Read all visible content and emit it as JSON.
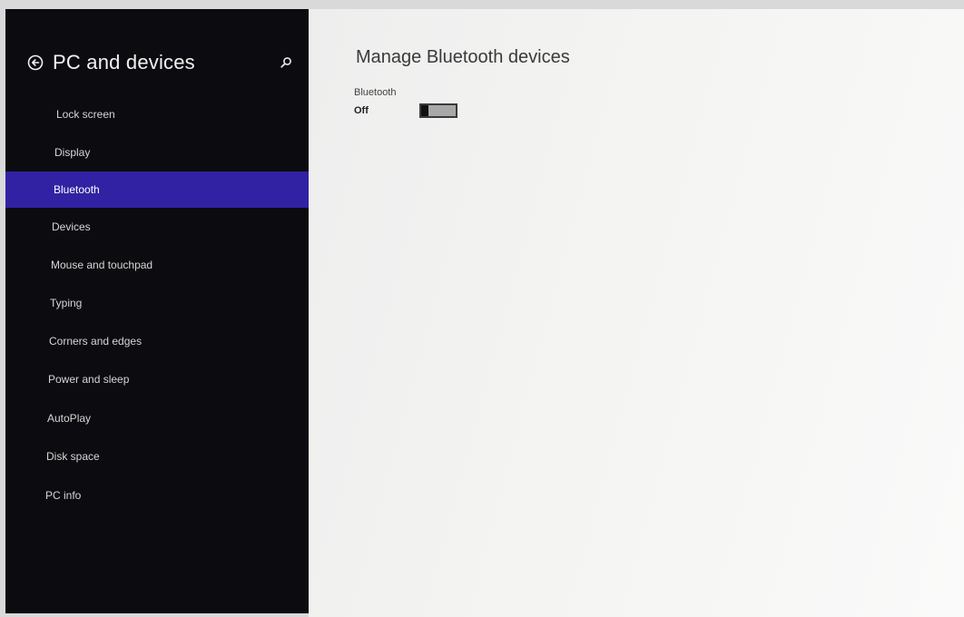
{
  "sidebar": {
    "title": "PC and devices",
    "back_icon": "back-arrow-circle-icon",
    "search_icon": "search-icon",
    "items": [
      {
        "label": "Lock screen",
        "selected": false
      },
      {
        "label": "Display",
        "selected": false
      },
      {
        "label": "Bluetooth",
        "selected": true
      },
      {
        "label": "Devices",
        "selected": false
      },
      {
        "label": "Mouse and touchpad",
        "selected": false
      },
      {
        "label": "Typing",
        "selected": false
      },
      {
        "label": "Corners and edges",
        "selected": false
      },
      {
        "label": "Power and sleep",
        "selected": false
      },
      {
        "label": "AutoPlay",
        "selected": false
      },
      {
        "label": "Disk space",
        "selected": false
      },
      {
        "label": "PC info",
        "selected": false
      }
    ]
  },
  "main": {
    "title": "Manage Bluetooth devices",
    "bluetooth_setting": {
      "label": "Bluetooth",
      "state": "Off",
      "enabled": false
    }
  },
  "colors": {
    "sidebar_background": "#0c0c10",
    "selection_accent": "#3022a3",
    "content_background": "#f4f4f2"
  }
}
